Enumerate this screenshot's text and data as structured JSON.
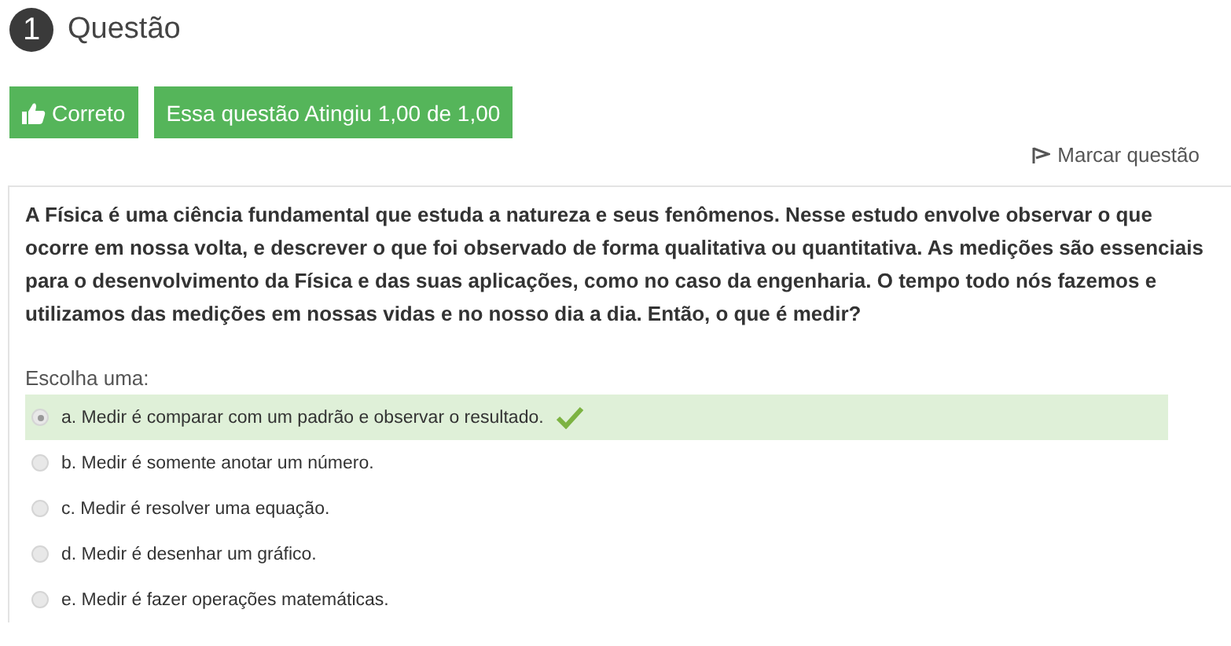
{
  "question": {
    "number": "1",
    "title": "Questão"
  },
  "badges": {
    "status": "Correto",
    "grade": "Essa questão Atingiu 1,00 de 1,00"
  },
  "flag": {
    "label": "Marcar questão"
  },
  "text": "A Física é uma ciência fundamental que estuda a natureza e seus fenômenos. Nesse estudo envolve observar o que ocorre em nossa volta, e descrever o que foi observado de forma qualitativa ou quantitativa. As medições são essenciais para o desenvolvimento da Física e das suas aplicações, como no caso da engenharia. O tempo todo nós fazemos e utilizamos das medições em nossas vidas e no nosso dia a dia. Então, o que é medir?",
  "prompt": "Escolha uma:",
  "options": [
    {
      "label": "a. Medir é comparar com um padrão e observar o resultado.",
      "selected": true,
      "correct": true
    },
    {
      "label": "b. Medir é somente anotar um número.",
      "selected": false,
      "correct": false
    },
    {
      "label": "c. Medir é resolver uma equação.",
      "selected": false,
      "correct": false
    },
    {
      "label": "d. Medir é desenhar um gráfico.",
      "selected": false,
      "correct": false
    },
    {
      "label": "e. Medir é fazer operações matemáticas.",
      "selected": false,
      "correct": false
    }
  ]
}
